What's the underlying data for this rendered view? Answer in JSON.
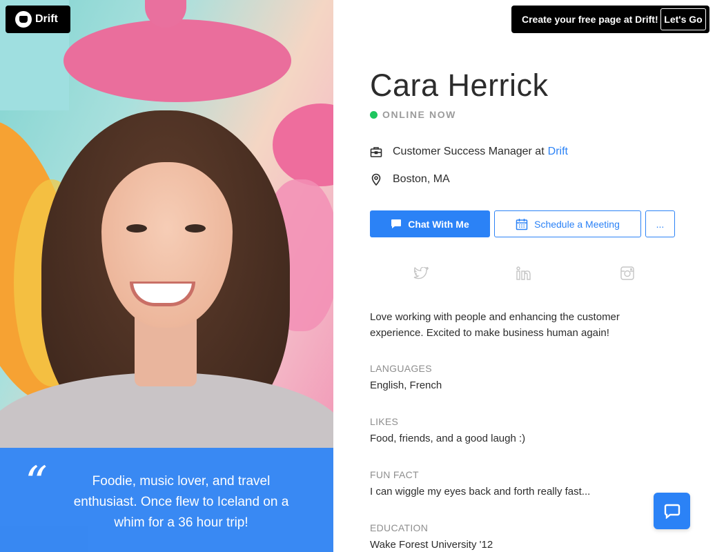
{
  "header": {
    "logo_text": "Drift",
    "promo_text": "Create your free page at Drift!",
    "promo_button": "Let's Go"
  },
  "profile": {
    "name": "Cara Herrick",
    "status": "ONLINE NOW",
    "status_color": "#1ec65e",
    "title": "Customer Success Manager at",
    "company_link": "Drift",
    "location": "Boston, MA"
  },
  "actions": {
    "chat_label": "Chat With Me",
    "meeting_label": "Schedule a Meeting",
    "more_label": "..."
  },
  "social": [
    "twitter-icon",
    "linkedin-icon",
    "instagram-icon"
  ],
  "bio": "Love working with people and enhancing the customer experience. Excited to make business human again!",
  "sections": [
    {
      "label": "LANGUAGES",
      "value": "English, French"
    },
    {
      "label": "LIKES",
      "value": "Food, friends, and a good laugh :)"
    },
    {
      "label": "FUN FACT",
      "value": "I can wiggle my eyes back and forth really fast..."
    },
    {
      "label": "EDUCATION",
      "value": "Wake Forest University '12"
    }
  ],
  "quote": {
    "mark": "“",
    "text": "Foodie, music lover, and travel enthusiast. Once flew to Iceland on a whim for a 36 hour trip!"
  },
  "colors": {
    "accent": "#2b82f6",
    "quote_bg": "#2c83f6"
  }
}
